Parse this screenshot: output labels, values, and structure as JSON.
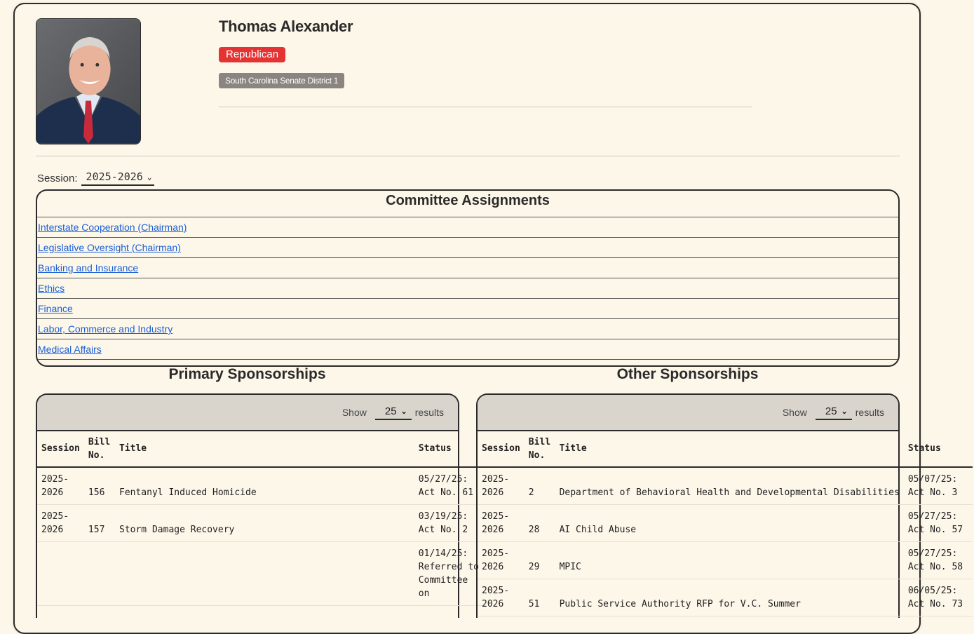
{
  "profile": {
    "name": "Thomas Alexander",
    "party": "Republican",
    "district": "South Carolina Senate District 1"
  },
  "session": {
    "label": "Session:",
    "value": "2025-2026"
  },
  "committees": {
    "title": "Committee Assignments",
    "items": [
      "Interstate Cooperation (Chairman)",
      "Legislative Oversight (Chairman)",
      "Banking and Insurance",
      "Ethics",
      "Finance",
      "Labor, Commerce and Industry",
      "Medical Affairs"
    ]
  },
  "primary": {
    "title": "Primary Sponsorships",
    "show": "Show",
    "count": "25",
    "results": "results",
    "headers": {
      "session": "Session",
      "bill_line1": "Bill",
      "bill_line2": "No.",
      "title": "Title",
      "status": "Status"
    },
    "rows": [
      {
        "s1": "2025-",
        "s2": "2026",
        "bill": "156",
        "title": "Fentanyl Induced Homicide",
        "st1": "05/27/25:",
        "st2": "Act No. 61"
      },
      {
        "s1": "2025-",
        "s2": "2026",
        "bill": "157",
        "title": "Storm Damage Recovery",
        "st1": "03/19/25:",
        "st2": "Act No. 2"
      },
      {
        "s1": "",
        "s2": "",
        "bill": "",
        "title": "",
        "st1": "01/14/25:",
        "st2": "Referred to",
        "st3": "Committee",
        "st4": "on"
      }
    ]
  },
  "other": {
    "title": "Other Sponsorships",
    "show": "Show",
    "count": "25",
    "results": "results",
    "headers": {
      "session": "Session",
      "bill_line1": "Bill",
      "bill_line2": "No.",
      "title": "Title",
      "status": "Status"
    },
    "rows": [
      {
        "s1": "2025-",
        "s2": "2026",
        "bill": "2",
        "title": "Department of Behavioral Health and Developmental Disabilities",
        "st1": "05/07/25:",
        "st2": "Act No. 3"
      },
      {
        "s1": "2025-",
        "s2": "2026",
        "bill": "28",
        "title": "AI Child Abuse",
        "st1": "05/27/25:",
        "st2": "Act No. 57"
      },
      {
        "s1": "2025-",
        "s2": "2026",
        "bill": "29",
        "title": "MPIC",
        "st1": "05/27/25:",
        "st2": "Act No. 58"
      },
      {
        "s1": "2025-",
        "s2": "2026",
        "bill": "51",
        "title": "Public Service Authority RFP for V.C. Summer",
        "st1": "06/05/25:",
        "st2": "Act No. 73"
      }
    ]
  }
}
